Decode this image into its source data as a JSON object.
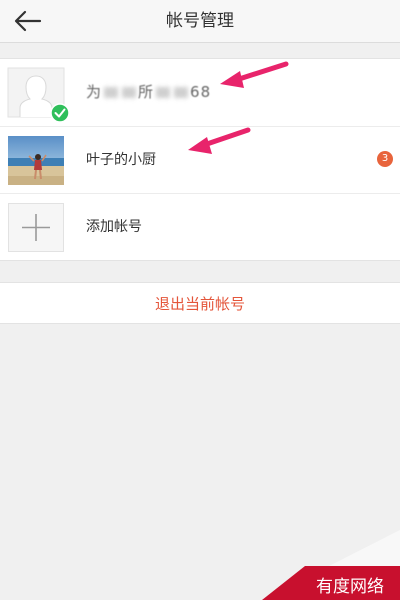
{
  "header": {
    "title": "帐号管理",
    "back_icon": "arrow-left-icon"
  },
  "accounts": [
    {
      "label_visible_start": "为",
      "label_visible_mid": "所",
      "label_visible_end": "68",
      "status_icon": "check-circle-icon",
      "status_color": "#2fbf5b"
    },
    {
      "label": "叶子的小厨",
      "badge_count": "3",
      "badge_color": "#e8643c"
    },
    {
      "label": "添加帐号",
      "icon": "plus-icon"
    }
  ],
  "logout_label": "退出当前帐号",
  "annotation_color": "#e8246b",
  "watermark": {
    "text": "有度网络",
    "color": "#c8102e"
  }
}
